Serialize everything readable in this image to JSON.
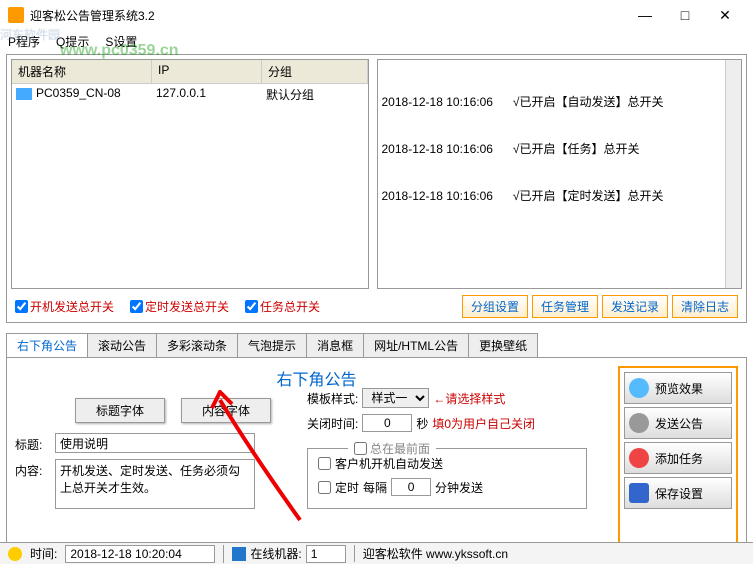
{
  "window": {
    "title": "迎客松公告管理系统3.2"
  },
  "watermark": {
    "main": "河东软件园",
    "sub": "www.pc0359.cn"
  },
  "menu": {
    "program": "P程序",
    "tip": "Q提示",
    "settings": "S设置"
  },
  "machine_table": {
    "headers": [
      "机器名称",
      "IP",
      "分组"
    ],
    "rows": [
      {
        "name": "PC0359_CN-08",
        "ip": "127.0.0.1",
        "group": "默认分组"
      }
    ]
  },
  "log_lines": [
    "2018-12-18 10:16:06      √已开启【自动发送】总开关",
    "2018-12-18 10:16:06      √已开启【任务】总开关",
    "2018-12-18 10:16:06      √已开启【定时发送】总开关"
  ],
  "checks": {
    "boot": "开机发送总开关",
    "timer": "定时发送总开关",
    "task": "任务总开关"
  },
  "blue_buttons": {
    "group": "分组设置",
    "task": "任务管理",
    "record": "发送记录",
    "clear": "清除日志"
  },
  "tabs": [
    "右下角公告",
    "滚动公告",
    "多彩滚动条",
    "气泡提示",
    "消息框",
    "网址/HTML公告",
    "更换壁纸"
  ],
  "form": {
    "heading": "右下角公告",
    "title_font_btn": "标题字体",
    "content_font_btn": "内容字体",
    "title_label": "标题:",
    "title_value": "使用说明",
    "content_label": "内容:",
    "content_value": "开机发送、定时发送、任务必须勾上总开关才生效。"
  },
  "opts": {
    "template_label": "模板样式:",
    "template_value": "样式一",
    "template_hint": "←请选择样式",
    "close_label": "关闭时间:",
    "close_value": "0",
    "close_unit": "秒",
    "close_hint": "填0为用户自己关闭",
    "topmost": "总在最前面",
    "auto_send": "客户机开机自动发送",
    "timer_prefix": "定时",
    "timer_label": "每隔",
    "timer_value": "0",
    "timer_unit": "分钟发送"
  },
  "side": {
    "preview": "预览效果",
    "send": "发送公告",
    "addtask": "添加任务",
    "save": "保存设置"
  },
  "status": {
    "time_label": "时间:",
    "time_value": "2018-12-18 10:20:04",
    "online_label": "在线机器:",
    "online_value": "1",
    "company": "迎客松软件 www.ykssoft.cn"
  }
}
